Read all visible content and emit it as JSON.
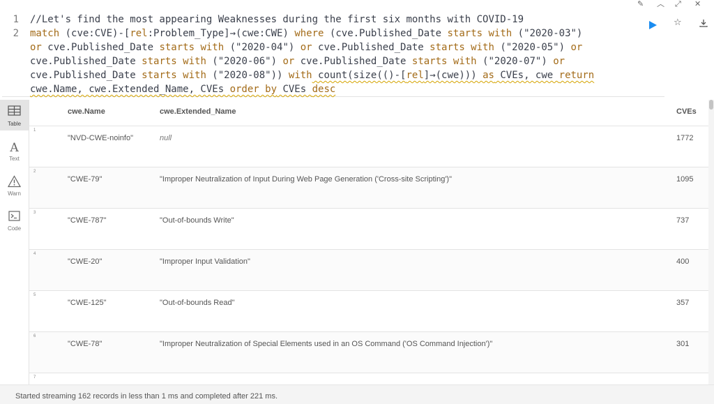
{
  "editor": {
    "line_numbers": [
      "1",
      "2"
    ],
    "line1": "//Let's find the most appearing Weaknesses during the first six months with COVID-19",
    "line2_parts": {
      "match": "match",
      "pattern": " (cve:CVE)-[",
      "rel": "rel",
      "pattern2": ":Problem_Type]→(cwe:CWE) ",
      "where": "where",
      "cond1": " (cve.Published_Date ",
      "starts_with": "starts with",
      "v1": " (\"2020-03\")"
    },
    "line3": {
      "or": "or",
      "field": " cve.Published_Date ",
      "sw": "starts with",
      "v": " (\"2020-04\") ",
      "or2": "or",
      "field2": " cve.Published_Date ",
      "sw2": "starts with",
      "v2": " (\"2020-05\") ",
      "or3": "or"
    },
    "line4": {
      "field": "cve.Published_Date ",
      "sw": "starts with",
      "v": " (\"2020-06\") ",
      "or": "or",
      "field2": " cve.Published_Date ",
      "sw2": "starts with",
      "v2": " (\"2020-07\") ",
      "or2": "or"
    },
    "line5": {
      "field": "cve.Published_Date ",
      "sw": "starts with",
      "v": " (\"2020-08\")) ",
      "with": "with",
      "cnt": " count(size(()-[",
      "rel": "rel",
      "rest": "]→(cwe))) ",
      "as": "as",
      "alias": " CVEs, cwe ",
      "ret": "return"
    },
    "line6": {
      "fields": "cwe.Name, cwe.Extended_Name, CVEs ",
      "order": "order by",
      "sp": " CVEs ",
      "desc": "desc"
    }
  },
  "sidebar": {
    "items": [
      {
        "label": "Table",
        "icon": "table-icon",
        "active": true
      },
      {
        "label": "Text",
        "icon": "text-icon",
        "active": false
      },
      {
        "label": "Warn",
        "icon": "warning-icon",
        "active": false
      },
      {
        "label": "Code",
        "icon": "code-icon",
        "active": false
      }
    ]
  },
  "table": {
    "headers": [
      "cwe.Name",
      "cwe.Extended_Name",
      "CVEs"
    ],
    "rows": [
      {
        "index": "1",
        "name": "\"NVD-CWE-noinfo\"",
        "extended": "null",
        "cves": "1772"
      },
      {
        "index": "2",
        "name": "\"CWE-79\"",
        "extended": "\"Improper Neutralization of Input During Web Page Generation ('Cross-site Scripting')\"",
        "cves": "1095"
      },
      {
        "index": "3",
        "name": "\"CWE-787\"",
        "extended": "\"Out-of-bounds Write\"",
        "cves": "737"
      },
      {
        "index": "4",
        "name": "\"CWE-20\"",
        "extended": "\"Improper Input Validation\"",
        "cves": "400"
      },
      {
        "index": "5",
        "name": "\"CWE-125\"",
        "extended": "\"Out-of-bounds Read\"",
        "cves": "357"
      },
      {
        "index": "6",
        "name": "\"CWE-78\"",
        "extended": "\"Improper Neutralization of Special Elements used in an OS Command ('OS Command Injection')\"",
        "cves": "301"
      },
      {
        "index": "7",
        "name": "",
        "extended": "",
        "cves": ""
      }
    ]
  },
  "status": {
    "text": "Started streaming 162 records in less than 1 ms and completed after 221 ms."
  },
  "colors": {
    "run": "#1a8cf0",
    "keyword": "#a36b18",
    "active_tab_bg": "#e4e4e4"
  }
}
